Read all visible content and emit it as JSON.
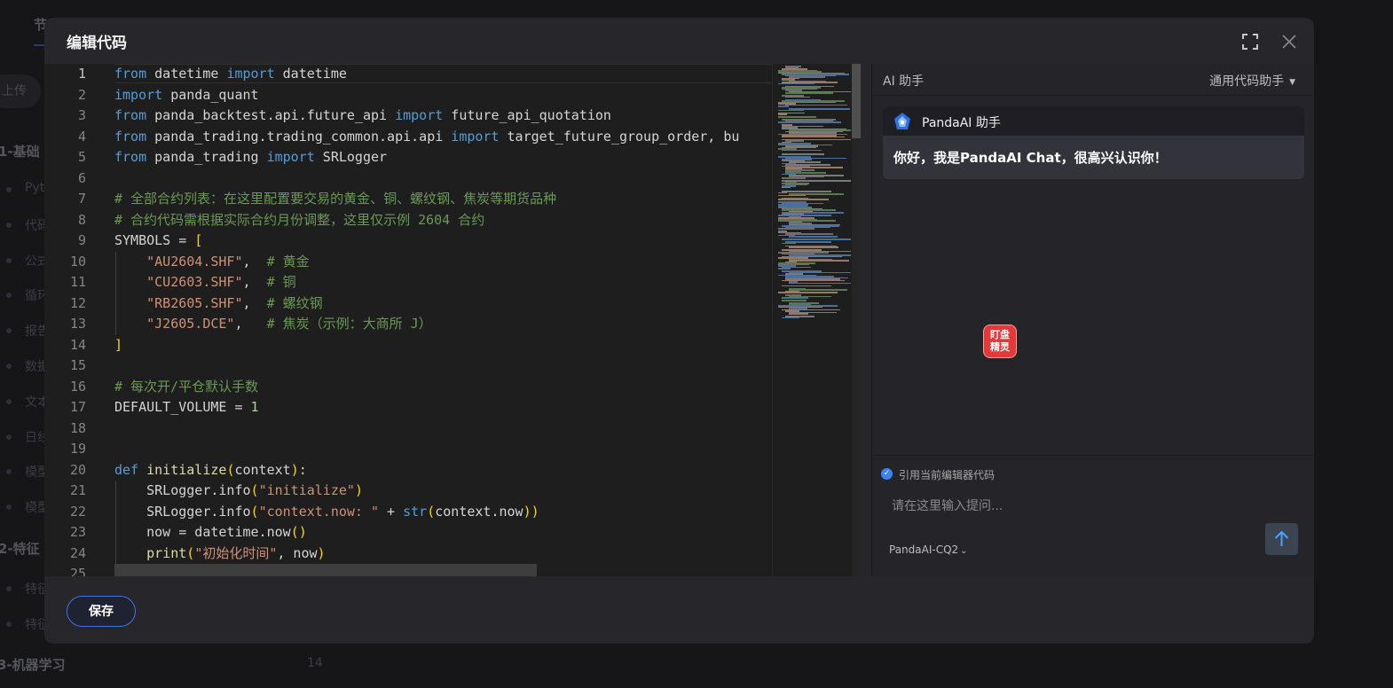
{
  "background": {
    "tab_fragment": "节",
    "upload_fragment": "上传",
    "section1_fragment": "1-基础",
    "section2_fragment": "2-特征",
    "section3": "3-机器学习",
    "section3_count": "14",
    "items": [
      "Pyt",
      "代码",
      "公式",
      "循环",
      "报告",
      "数据",
      "文本",
      "日线",
      "模型",
      "模型"
    ],
    "items2": [
      "特征",
      "特征"
    ]
  },
  "modal": {
    "title": "编辑代码",
    "save_label": "保存"
  },
  "editor": {
    "lines": [
      [
        {
          "t": "from",
          "c": "kw"
        },
        {
          "t": " datetime ",
          "c": "pl"
        },
        {
          "t": "import",
          "c": "kw"
        },
        {
          "t": " datetime",
          "c": "pl"
        }
      ],
      [
        {
          "t": "import",
          "c": "kw"
        },
        {
          "t": " panda_quant",
          "c": "pl"
        }
      ],
      [
        {
          "t": "from",
          "c": "kw"
        },
        {
          "t": " panda_backtest.api.future_api ",
          "c": "pl"
        },
        {
          "t": "import",
          "c": "kw"
        },
        {
          "t": " future_api_quotation",
          "c": "pl"
        }
      ],
      [
        {
          "t": "from",
          "c": "kw"
        },
        {
          "t": " panda_trading.trading_common.api.api ",
          "c": "pl"
        },
        {
          "t": "import",
          "c": "kw"
        },
        {
          "t": " target_future_group_order, bu",
          "c": "pl"
        }
      ],
      [
        {
          "t": "from",
          "c": "kw"
        },
        {
          "t": " panda_trading ",
          "c": "pl"
        },
        {
          "t": "import",
          "c": "kw"
        },
        {
          "t": " SRLogger",
          "c": "pl"
        }
      ],
      [],
      [
        {
          "t": "# 全部合约列表：在这里配置要交易的黄金、铜、螺纹钢、焦炭等期货品种",
          "c": "cm"
        }
      ],
      [
        {
          "t": "# 合约代码需根据实际合约月份调整，这里仅示例 2604 合约",
          "c": "cm"
        }
      ],
      [
        {
          "t": "SYMBOLS = ",
          "c": "pl"
        },
        {
          "t": "[",
          "c": "br"
        }
      ],
      [
        {
          "t": "    ",
          "c": "pl"
        },
        {
          "t": "\"AU2604.SHF\"",
          "c": "str"
        },
        {
          "t": ",  ",
          "c": "pl"
        },
        {
          "t": "# 黄金",
          "c": "cm"
        }
      ],
      [
        {
          "t": "    ",
          "c": "pl"
        },
        {
          "t": "\"CU2603.SHF\"",
          "c": "str"
        },
        {
          "t": ",  ",
          "c": "pl"
        },
        {
          "t": "# 铜",
          "c": "cm"
        }
      ],
      [
        {
          "t": "    ",
          "c": "pl"
        },
        {
          "t": "\"RB2605.SHF\"",
          "c": "str"
        },
        {
          "t": ",  ",
          "c": "pl"
        },
        {
          "t": "# 螺纹钢",
          "c": "cm"
        }
      ],
      [
        {
          "t": "    ",
          "c": "pl"
        },
        {
          "t": "\"J2605.DCE\"",
          "c": "str"
        },
        {
          "t": ",   ",
          "c": "pl"
        },
        {
          "t": "# 焦炭（示例：大商所 J）",
          "c": "cm"
        }
      ],
      [
        {
          "t": "]",
          "c": "br"
        }
      ],
      [],
      [
        {
          "t": "# 每次开/平仓默认手数",
          "c": "cm"
        }
      ],
      [
        {
          "t": "DEFAULT_VOLUME = ",
          "c": "pl"
        },
        {
          "t": "1",
          "c": "num"
        }
      ],
      [],
      [],
      [
        {
          "t": "def",
          "c": "kw"
        },
        {
          "t": " ",
          "c": "pl"
        },
        {
          "t": "initialize",
          "c": "fn"
        },
        {
          "t": "(",
          "c": "br"
        },
        {
          "t": "context",
          "c": "pl"
        },
        {
          "t": ")",
          "c": "br"
        },
        {
          "t": ":",
          "c": "pl"
        }
      ],
      [
        {
          "t": "    SRLogger.info",
          "c": "pl"
        },
        {
          "t": "(",
          "c": "br"
        },
        {
          "t": "\"initialize\"",
          "c": "str"
        },
        {
          "t": ")",
          "c": "br"
        }
      ],
      [
        {
          "t": "    SRLogger.info",
          "c": "pl"
        },
        {
          "t": "(",
          "c": "br"
        },
        {
          "t": "\"context.now: \"",
          "c": "str"
        },
        {
          "t": " + ",
          "c": "pl"
        },
        {
          "t": "str",
          "c": "kw"
        },
        {
          "t": "(",
          "c": "br"
        },
        {
          "t": "context.now",
          "c": "pl"
        },
        {
          "t": "))",
          "c": "br"
        }
      ],
      [
        {
          "t": "    now = datetime.now",
          "c": "pl"
        },
        {
          "t": "()",
          "c": "br"
        }
      ],
      [
        {
          "t": "    ",
          "c": "pl"
        },
        {
          "t": "print",
          "c": "fn"
        },
        {
          "t": "(",
          "c": "br"
        },
        {
          "t": "\"初始化时间\"",
          "c": "str"
        },
        {
          "t": ", now",
          "c": "pl"
        },
        {
          "t": ")",
          "c": "br"
        }
      ],
      []
    ]
  },
  "ai_panel": {
    "title": "AI 助手",
    "mode_label": "通用代码助手",
    "bot_name": "PandaAI 助手",
    "greeting": "你好，我是PandaAI Chat，很高兴认识你！",
    "badge_text": "盯盘精灵",
    "reference_label": "引用当前编辑器代码",
    "reference_checked": true,
    "input_placeholder": "请在这里输入提问...",
    "model_label": "PandaAI-CQ2"
  },
  "colors": {
    "accent": "#3f74e6",
    "keyword": "#569cd6",
    "string": "#ce9178",
    "comment": "#6a9955",
    "bracket": "#ffd700"
  }
}
